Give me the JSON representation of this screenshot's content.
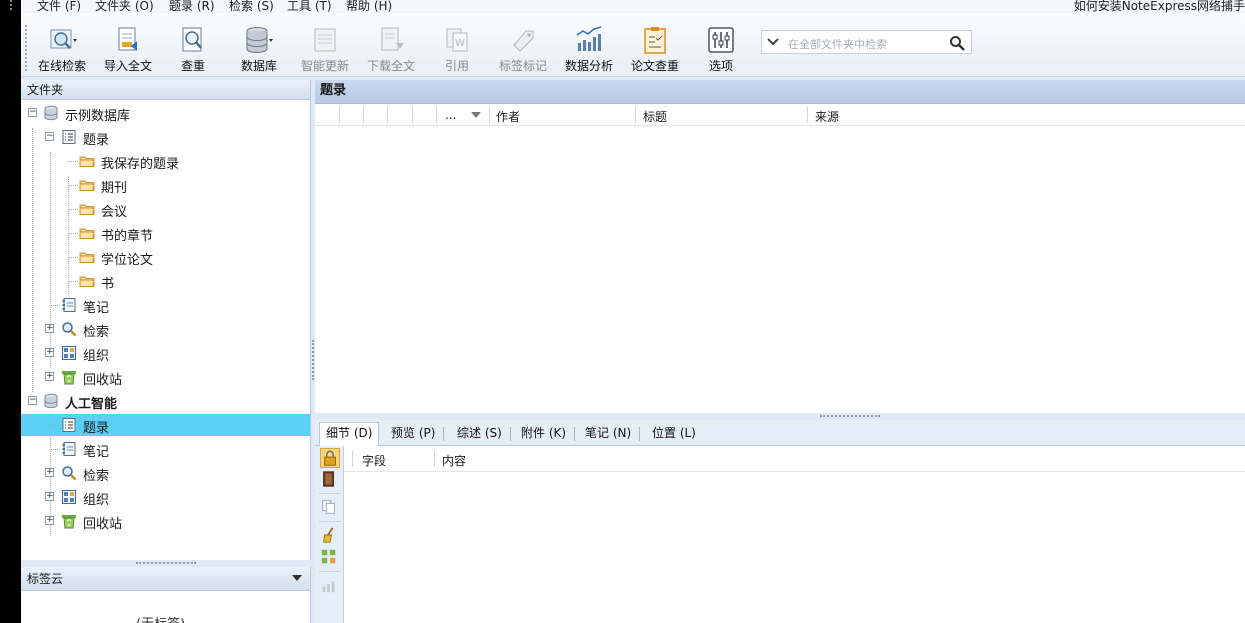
{
  "app": {
    "title": "如何安装NoteExpress网络捕手"
  },
  "menu": [
    {
      "label": "文件 (F)"
    },
    {
      "label": "文件夹 (O)"
    },
    {
      "label": "题录 (R)"
    },
    {
      "label": "检索 (S)"
    },
    {
      "label": "工具 (T)"
    },
    {
      "label": "帮助 (H)"
    }
  ],
  "toolbar": {
    "buttons": [
      {
        "label": "在线检索",
        "icon": "online-search-icon",
        "enabled": true
      },
      {
        "label": "导入全文",
        "icon": "import-fulltext-icon",
        "enabled": true
      },
      {
        "label": "查重",
        "icon": "find-duplicates-icon",
        "enabled": true
      },
      {
        "label": "数据库",
        "icon": "database-icon",
        "enabled": true
      },
      {
        "label": "智能更新",
        "icon": "smart-update-icon",
        "enabled": false
      },
      {
        "label": "下载全文",
        "icon": "download-fulltext-icon",
        "enabled": false
      },
      {
        "label": "引用",
        "icon": "cite-icon",
        "enabled": false
      },
      {
        "label": "标签标记",
        "icon": "tag-icon",
        "enabled": false
      },
      {
        "label": "数据分析",
        "icon": "data-analysis-icon",
        "enabled": true
      },
      {
        "label": "论文查重",
        "icon": "paper-check-icon",
        "enabled": true
      },
      {
        "label": "选项",
        "icon": "options-icon",
        "enabled": true
      }
    ],
    "search": {
      "placeholder": "在全部文件夹中检索"
    }
  },
  "folders": {
    "header": "文件夹",
    "tree": [
      {
        "label": "示例数据库",
        "icon": "database-icon",
        "expander": "minus",
        "bold": false
      },
      {
        "label": "题录",
        "icon": "records-icon",
        "expander": "minus",
        "bold": false
      },
      {
        "label": "我保存的题录",
        "icon": "folder-icon",
        "expander": null,
        "bold": false
      },
      {
        "label": "期刊",
        "icon": "folder-icon",
        "expander": null,
        "bold": false
      },
      {
        "label": "会议",
        "icon": "folder-icon",
        "expander": null,
        "bold": false
      },
      {
        "label": "书的章节",
        "icon": "folder-icon",
        "expander": null,
        "bold": false
      },
      {
        "label": "学位论文",
        "icon": "folder-icon",
        "expander": null,
        "bold": false
      },
      {
        "label": "书",
        "icon": "folder-icon",
        "expander": null,
        "bold": false
      },
      {
        "label": "笔记",
        "icon": "notes-icon",
        "expander": null,
        "bold": false
      },
      {
        "label": "检索",
        "icon": "search-icon",
        "expander": "plus",
        "bold": false
      },
      {
        "label": "组织",
        "icon": "organize-icon",
        "expander": "plus",
        "bold": false
      },
      {
        "label": "回收站",
        "icon": "recycle-bin-icon",
        "expander": "plus",
        "bold": false
      },
      {
        "label": "人工智能",
        "icon": "database-icon",
        "expander": "minus",
        "bold": true
      },
      {
        "label": "题录",
        "icon": "records-icon",
        "expander": null,
        "bold": false
      },
      {
        "label": "笔记",
        "icon": "notes-icon",
        "expander": null,
        "bold": false
      },
      {
        "label": "检索",
        "icon": "search-icon",
        "expander": "plus",
        "bold": false
      },
      {
        "label": "组织",
        "icon": "organize-icon",
        "expander": "plus",
        "bold": false
      },
      {
        "label": "回收站",
        "icon": "recycle-bin-icon",
        "expander": "plus",
        "bold": false
      }
    ]
  },
  "tagcloud": {
    "header": "标签云",
    "empty": "(无标签)"
  },
  "records": {
    "header": "题录",
    "columns": [
      "...",
      "作者",
      "标题",
      "来源"
    ]
  },
  "detail": {
    "tabs": [
      {
        "label": "细节 (D)",
        "active": true
      },
      {
        "label": "预览 (P)",
        "active": false
      },
      {
        "label": "综述 (S)",
        "active": false
      },
      {
        "label": "附件 (K)",
        "active": false
      },
      {
        "label": "笔记 (N)",
        "active": false
      },
      {
        "label": "位置 (L)",
        "active": false
      }
    ],
    "columns": [
      "字段",
      "内容"
    ]
  }
}
